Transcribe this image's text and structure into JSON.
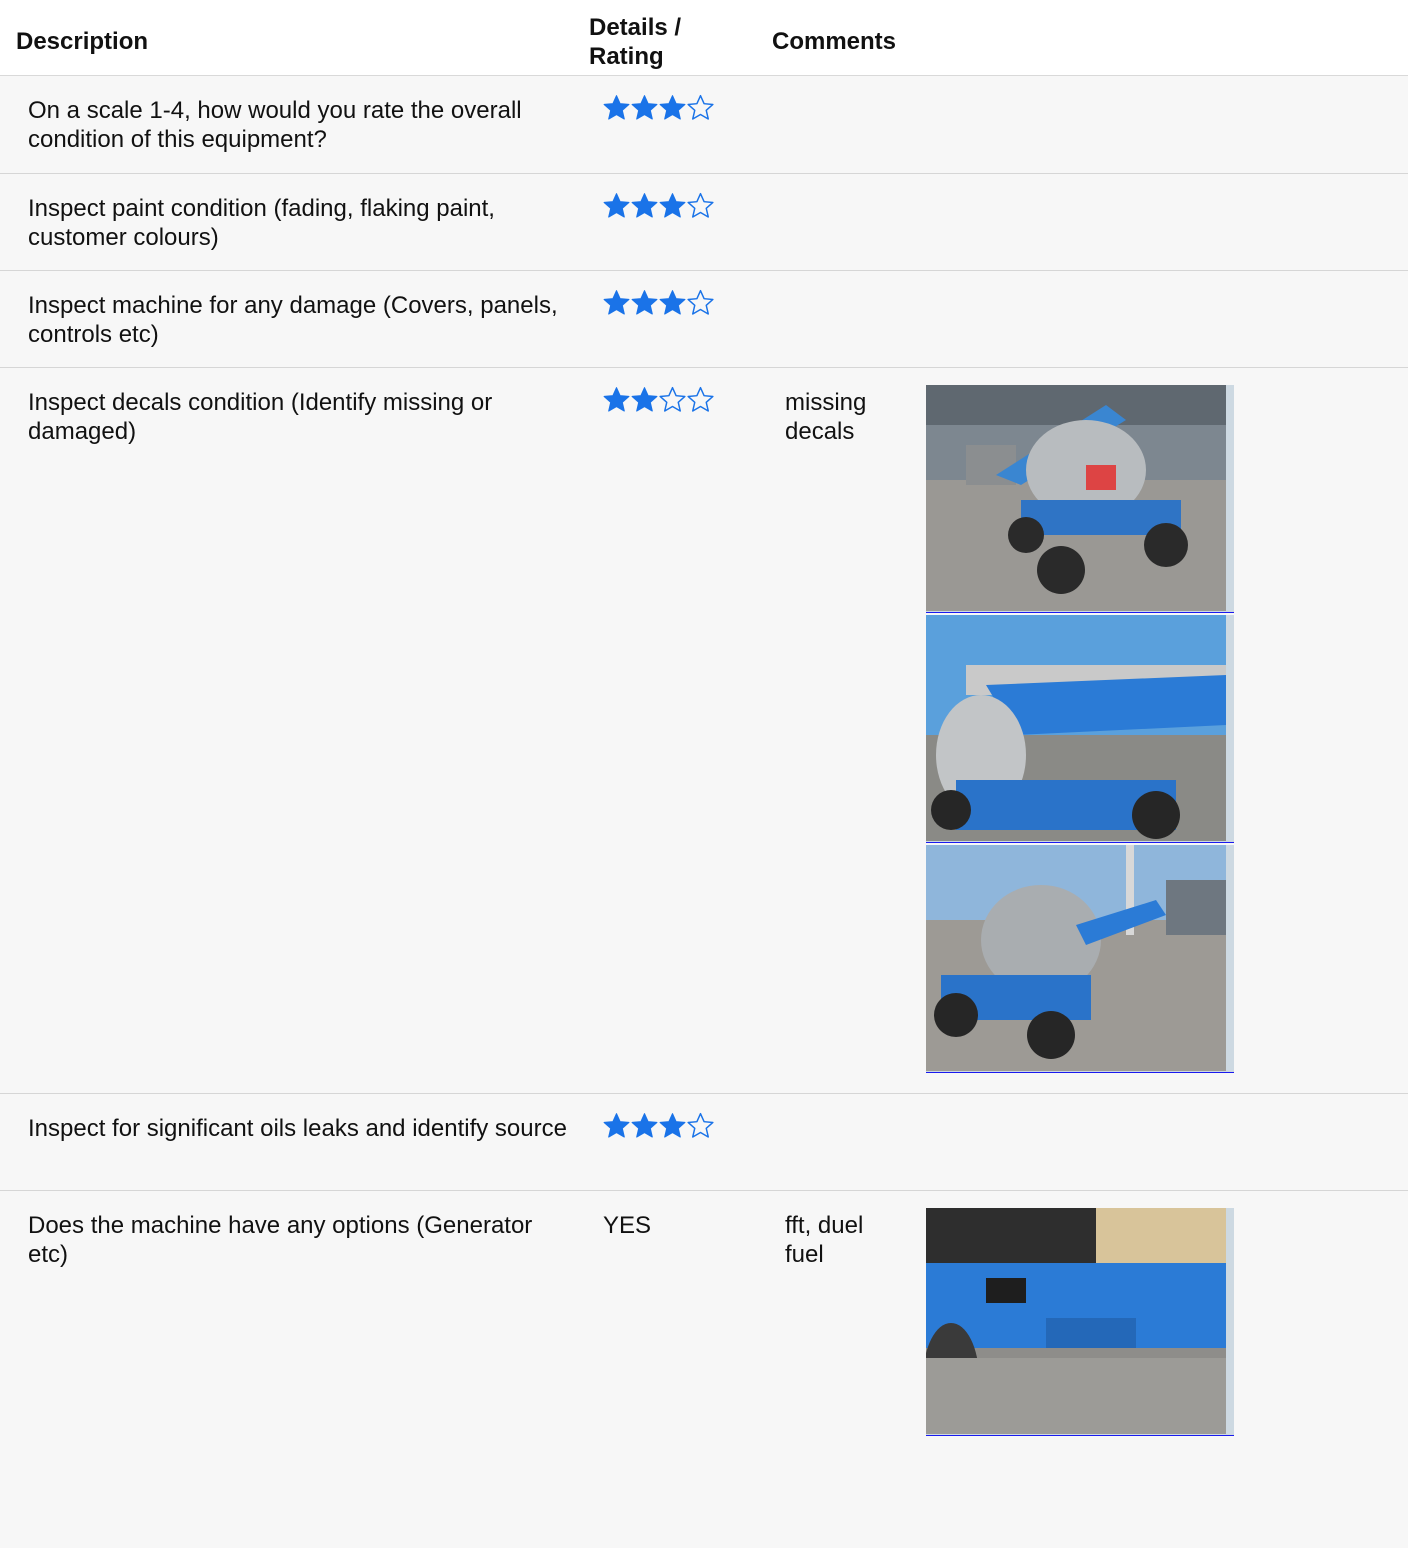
{
  "header": {
    "description": "Description",
    "rating": "Details / Rating",
    "comments": "Comments"
  },
  "rows": [
    {
      "description": "On a scale 1-4, how would you rate the overall condition of this equipment?",
      "rating": 3,
      "max": 4,
      "comment": "",
      "photos": []
    },
    {
      "description": "Inspect paint condition (fading, flaking paint, customer colours)",
      "rating": 3,
      "max": 4,
      "comment": "",
      "photos": []
    },
    {
      "description": "Inspect machine for any damage (Covers, panels, controls etc)",
      "rating": 3,
      "max": 4,
      "comment": "",
      "photos": []
    },
    {
      "description": "Inspect decals condition (Identify missing or damaged)",
      "rating": 2,
      "max": 4,
      "comment": "missing decals",
      "photos": [
        "boom-lift-front-view",
        "boom-lift-side-view",
        "boom-lift-rear-view"
      ]
    },
    {
      "description": "Inspect for significant oils leaks and identify source",
      "rating": 3,
      "max": 4,
      "comment": "",
      "photos": []
    },
    {
      "description": "Does the machine have any options (Generator etc)",
      "value": "YES",
      "comment": "fft, duel fuel",
      "photos": [
        "machine-underside-view"
      ]
    }
  ],
  "colors": {
    "star": "#1a73e8",
    "row_bg": "#f7f7f7",
    "link_underline": "#1a1aee"
  }
}
